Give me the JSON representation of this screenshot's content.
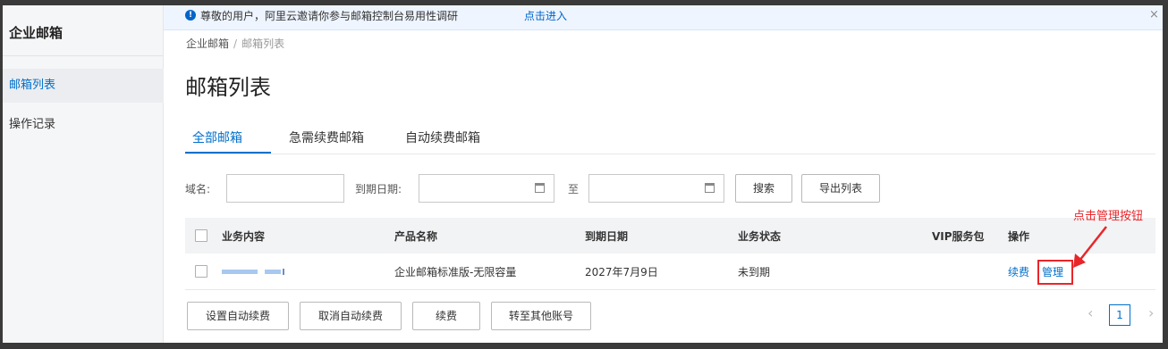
{
  "sidebar": {
    "title": "企业邮箱",
    "items": [
      {
        "label": "邮箱列表",
        "active": true
      },
      {
        "label": "操作记录",
        "active": false
      }
    ]
  },
  "notice": {
    "icon": "info-icon",
    "text": "尊敬的用户，阿里云邀请你参与邮箱控制台易用性调研",
    "link": "点击进入",
    "close": "×"
  },
  "breadcrumb": {
    "root": "企业邮箱",
    "separator": "/",
    "current": "邮箱列表"
  },
  "page_title": "邮箱列表",
  "tabs": [
    {
      "label": "全部邮箱",
      "active": true
    },
    {
      "label": "急需续费邮箱",
      "active": false
    },
    {
      "label": "自动续费邮箱",
      "active": false
    }
  ],
  "filters": {
    "domain_label": "域名:",
    "domain_value": "",
    "expiry_label": "到期日期:",
    "date_from": "",
    "to_label": "至",
    "date_to": "",
    "search_button": "搜索",
    "export_button": "导出列表"
  },
  "table": {
    "columns": [
      "业务内容",
      "产品名称",
      "到期日期",
      "业务状态",
      "VIP服务包",
      "操作"
    ],
    "rows": [
      {
        "business": "",
        "product": "企业邮箱标准版-无限容量",
        "expiry": "2027年7月9日",
        "status": "未到期",
        "vip": "",
        "actions": {
          "renew": "续费",
          "manage": "管理"
        }
      }
    ]
  },
  "annotation": {
    "text": "点击管理按钮",
    "color": "#e8262a"
  },
  "footer_buttons": [
    "设置自动续费",
    "取消自动续费",
    "续费",
    "转至其他账号"
  ],
  "pagination": {
    "prev": "‹",
    "current_page": "1",
    "next": "›"
  },
  "colors": {
    "accent": "#0070cc",
    "annotation": "#e8262a"
  }
}
